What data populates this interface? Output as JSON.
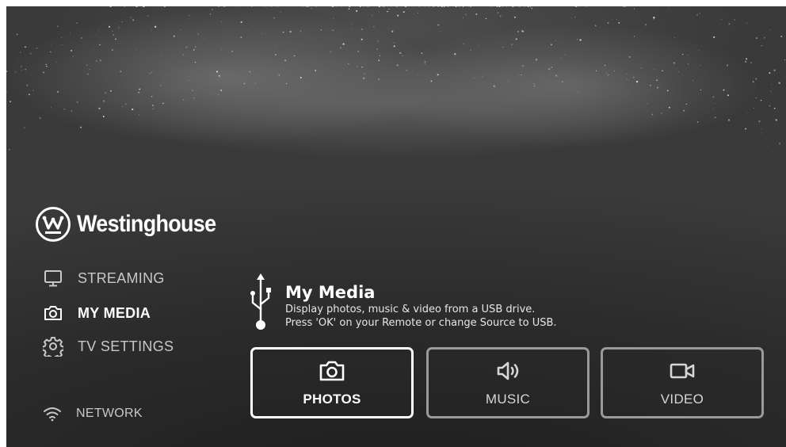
{
  "brand": {
    "name": "Westinghouse",
    "logo_icon": "westinghouse-w-logo"
  },
  "nav": {
    "items": [
      {
        "label": "STREAMING",
        "icon": "tv-monitor-icon",
        "active": false
      },
      {
        "label": "MY MEDIA",
        "icon": "camera-icon",
        "active": true
      },
      {
        "label": "TV SETTINGS",
        "icon": "gear-icon",
        "active": false
      }
    ],
    "network": {
      "label": "NETWORK",
      "icon": "wifi-icon"
    }
  },
  "section": {
    "icon": "usb-icon",
    "title": "My Media",
    "line1": "Display photos, music & video from a USB drive.",
    "line2": "Press 'OK' on your Remote or change Source to USB."
  },
  "tiles": [
    {
      "label": "PHOTOS",
      "icon": "camera-icon",
      "selected": true
    },
    {
      "label": "MUSIC",
      "icon": "speaker-icon",
      "selected": false
    },
    {
      "label": "VIDEO",
      "icon": "video-camera-icon",
      "selected": false
    }
  ],
  "colors": {
    "background": "#2c2c2c",
    "text": "#ffffff",
    "inactive_text": "#c8c8c8",
    "tile_border": "#9a9a9a",
    "selected_border": "#ffffff"
  }
}
